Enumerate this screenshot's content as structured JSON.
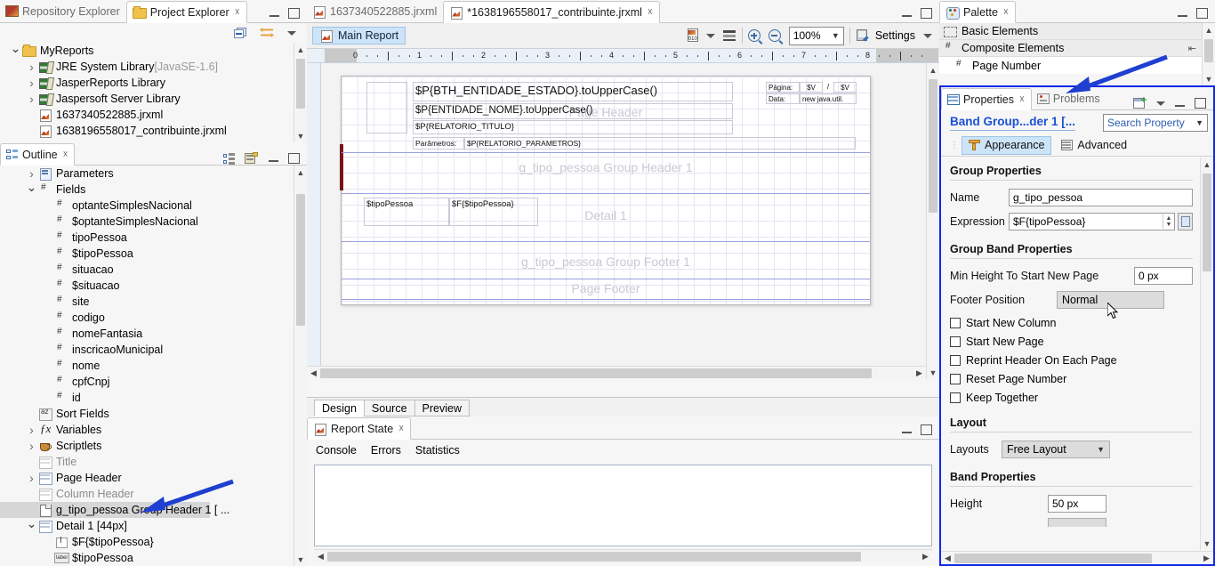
{
  "project_explorer": {
    "tabs": [
      {
        "label": "Repository Explorer",
        "icon": "repository-icon",
        "active": false
      },
      {
        "label": "Project Explorer",
        "icon": "project-icon",
        "active": true
      }
    ],
    "toolbar": [
      "collapse-all-icon",
      "link-with-editor-icon",
      "view-menu-icon"
    ],
    "tree": [
      {
        "label": "MyReports",
        "icon": "folder-icon",
        "indent": 0,
        "twisty": "open"
      },
      {
        "label": "JRE System Library",
        "suffix": " [JavaSE-1.6]",
        "icon": "library-icon",
        "indent": 1,
        "twisty": "closed"
      },
      {
        "label": "JasperReports Library",
        "icon": "library-icon",
        "indent": 1,
        "twisty": "closed"
      },
      {
        "label": "Jaspersoft Server Library",
        "icon": "library-icon",
        "indent": 1,
        "twisty": "closed"
      },
      {
        "label": "1637340522885.jrxml",
        "icon": "jrxml-file-icon",
        "indent": 1,
        "twisty": "none"
      },
      {
        "label": "1638196558017_contribuinte.jrxml",
        "icon": "jrxml-file-icon",
        "indent": 1,
        "twisty": "none"
      }
    ]
  },
  "outline": {
    "tab_label": "Outline",
    "toolbar": [
      "tree-layout-icon",
      "report-structure-icon"
    ],
    "tree": [
      {
        "label": "Parameters",
        "icon": "parameters-icon",
        "indent": 1,
        "twisty": "closed"
      },
      {
        "label": "Fields",
        "icon": "field-icon",
        "indent": 1,
        "twisty": "open"
      },
      {
        "label": "optanteSimplesNacional",
        "icon": "field-icon",
        "indent": 2,
        "twisty": "none"
      },
      {
        "label": "$optanteSimplesNacional",
        "icon": "field-icon",
        "indent": 2,
        "twisty": "none"
      },
      {
        "label": "tipoPessoa",
        "icon": "field-icon",
        "indent": 2,
        "twisty": "none"
      },
      {
        "label": "$tipoPessoa",
        "icon": "field-icon",
        "indent": 2,
        "twisty": "none"
      },
      {
        "label": "situacao",
        "icon": "field-icon",
        "indent": 2,
        "twisty": "none"
      },
      {
        "label": "$situacao",
        "icon": "field-icon",
        "indent": 2,
        "twisty": "none"
      },
      {
        "label": "site",
        "icon": "field-icon",
        "indent": 2,
        "twisty": "none"
      },
      {
        "label": "codigo",
        "icon": "field-icon",
        "indent": 2,
        "twisty": "none"
      },
      {
        "label": "nomeFantasia",
        "icon": "field-icon",
        "indent": 2,
        "twisty": "none"
      },
      {
        "label": "inscricaoMunicipal",
        "icon": "field-icon",
        "indent": 2,
        "twisty": "none"
      },
      {
        "label": "nome",
        "icon": "field-icon",
        "indent": 2,
        "twisty": "none"
      },
      {
        "label": "cpfCnpj",
        "icon": "field-icon",
        "indent": 2,
        "twisty": "none"
      },
      {
        "label": "id",
        "icon": "field-icon",
        "indent": 2,
        "twisty": "none"
      },
      {
        "label": "Sort Fields",
        "icon": "sort-fields-icon",
        "indent": 1,
        "twisty": "none"
      },
      {
        "label": "Variables",
        "icon": "variables-icon",
        "indent": 1,
        "twisty": "closed"
      },
      {
        "label": "Scriptlets",
        "icon": "scriptlets-icon",
        "indent": 1,
        "twisty": "closed"
      },
      {
        "label": "Title",
        "icon": "band-icon",
        "indent": 1,
        "twisty": "none",
        "state": "disabled"
      },
      {
        "label": "Page Header",
        "icon": "band-icon",
        "indent": 1,
        "twisty": "closed"
      },
      {
        "label": "Column Header",
        "icon": "band-icon",
        "indent": 1,
        "twisty": "none",
        "state": "disabled"
      },
      {
        "label": "g_tipo_pessoa Group Header 1 [ ...",
        "icon": "group-header-icon",
        "indent": 1,
        "twisty": "none",
        "state": "selected"
      },
      {
        "label": "Detail 1 [44px]",
        "icon": "band-icon",
        "indent": 1,
        "twisty": "open"
      },
      {
        "label": "$F{$tipoPessoa}",
        "icon": "textfield-icon",
        "indent": 2,
        "twisty": "none"
      },
      {
        "label": "$tipoPessoa",
        "icon": "label-icon",
        "indent": 2,
        "twisty": "none"
      }
    ]
  },
  "editor": {
    "tabs": [
      {
        "label": "1637340522885.jrxml",
        "icon": "jrxml-file-icon",
        "active": false,
        "closable": false
      },
      {
        "label": "*1638196558017_contribuinte.jrxml",
        "icon": "jrxml-file-icon",
        "active": true,
        "closable": true
      }
    ],
    "toolbar": {
      "main_report_label": "Main Report",
      "dataset_icon": "dataset-icon",
      "dropdown_icon": "chevron-down-icon",
      "list_icon": "list-icon",
      "zoom_in_icon": "zoom-in-icon",
      "zoom_out_icon": "zoom-out-icon",
      "zoom_value": "100%",
      "settings_label": "Settings",
      "settings_icon": "settings-icon"
    },
    "ruler_ticks": [
      "0",
      "1",
      "2",
      "3",
      "4",
      "5",
      "6",
      "7",
      "8"
    ],
    "bands": [
      {
        "name": "Page Header",
        "label": "Page Header"
      },
      {
        "name": "g_tipo_pessoa Group Header 1",
        "label": "g_tipo_pessoa Group Header 1"
      },
      {
        "name": "Detail 1",
        "label": "Detail 1"
      },
      {
        "name": "g_tipo_pessoa Group Footer 1",
        "label": "g_tipo_pessoa Group Footer 1"
      },
      {
        "name": "Page Footer",
        "label": "Page Footer"
      }
    ],
    "elements": {
      "entidade_estado": "$P{BTH_ENTIDADE_ESTADO}.toUpperCase()",
      "entidade_nome": "$P{ENTIDADE_NOME}.toUpperCase()",
      "relatorio_titulo": "$P{RELATORIO_TITULO}",
      "parametros_label": "Parâmetros:",
      "relatorio_parametros": "$P{RELATORIO_PARAMETROS}",
      "pagina_label": "Página:",
      "pagina_value_1": "$V",
      "pagina_sep": "/",
      "pagina_value_2": "$V",
      "data_label": "Data:",
      "data_value": "new java.util.",
      "detail_label": "$tipoPessoa",
      "detail_field": "$F{$tipoPessoa}"
    },
    "view_tabs": [
      {
        "label": "Design",
        "active": true
      },
      {
        "label": "Source",
        "active": false
      },
      {
        "label": "Preview",
        "active": false
      }
    ]
  },
  "report_state": {
    "tab_label": "Report State",
    "icon": "report-state-icon",
    "sub_tabs": [
      {
        "label": "Console",
        "active": true
      },
      {
        "label": "Errors",
        "active": false
      },
      {
        "label": "Statistics",
        "active": false
      }
    ],
    "console_text": ""
  },
  "palette": {
    "tab_label": "Palette",
    "icon": "palette-icon",
    "rows": [
      {
        "label": "Basic Elements",
        "icon": "dashed-box-icon",
        "type": "group"
      },
      {
        "label": "Composite Elements",
        "icon": "field-icon",
        "type": "group",
        "trailing_icon": "collapse-icon"
      },
      {
        "label": "Page Number",
        "icon": "field-icon",
        "type": "item"
      }
    ]
  },
  "properties": {
    "tabs": [
      {
        "label": "Properties",
        "icon": "properties-icon",
        "active": true,
        "closable": true
      },
      {
        "label": "Problems",
        "icon": "problems-icon",
        "active": false,
        "closable": false
      }
    ],
    "toolbar": [
      "new-view-icon",
      "view-menu-icon"
    ],
    "title": "Band Group...der 1 [...",
    "search_placeholder": "Search Property",
    "sub_tabs": [
      {
        "label": "Appearance",
        "icon": "appearance-icon",
        "active": true
      },
      {
        "label": "Advanced",
        "icon": "advanced-icon",
        "active": false
      }
    ],
    "sections": {
      "group_properties": {
        "title": "Group Properties",
        "fields": [
          {
            "label": "Name",
            "value": "g_tipo_pessoa",
            "type": "text"
          },
          {
            "label": "Expression",
            "value": "$F{tipoPessoa}",
            "type": "expression"
          }
        ]
      },
      "group_band_properties": {
        "title": "Group Band Properties",
        "fields": [
          {
            "label": "Min Height To Start New Page",
            "value": "0 px",
            "type": "text"
          },
          {
            "label": "Footer Position",
            "value": "Normal",
            "type": "combo"
          }
        ],
        "checkboxes": [
          {
            "label": "Start New Column",
            "checked": false
          },
          {
            "label": "Start New Page",
            "checked": false
          },
          {
            "label": "Reprint Header On Each Page",
            "checked": false
          },
          {
            "label": "Reset Page Number",
            "checked": false
          },
          {
            "label": "Keep Together",
            "checked": false
          }
        ]
      },
      "layout": {
        "title": "Layout",
        "fields": [
          {
            "label": "Layouts",
            "value": "Free Layout",
            "type": "combo"
          }
        ]
      },
      "band_properties": {
        "title": "Band Properties",
        "fields": [
          {
            "label": "Height",
            "value": "50 px",
            "type": "text"
          }
        ]
      }
    }
  },
  "annotations": {
    "arrow_color": "#1f3fd0",
    "arrows": [
      {
        "name": "palette-arrow",
        "target": "palette-panel"
      },
      {
        "name": "outline-group-header-arrow",
        "target": "outline-group-header-row"
      }
    ]
  },
  "colors": {
    "selection_blue": "#cde3f7",
    "highlight_border": "#1028e8",
    "title_blue": "#1a4fd6",
    "band_guide": "#9aa0e0"
  }
}
